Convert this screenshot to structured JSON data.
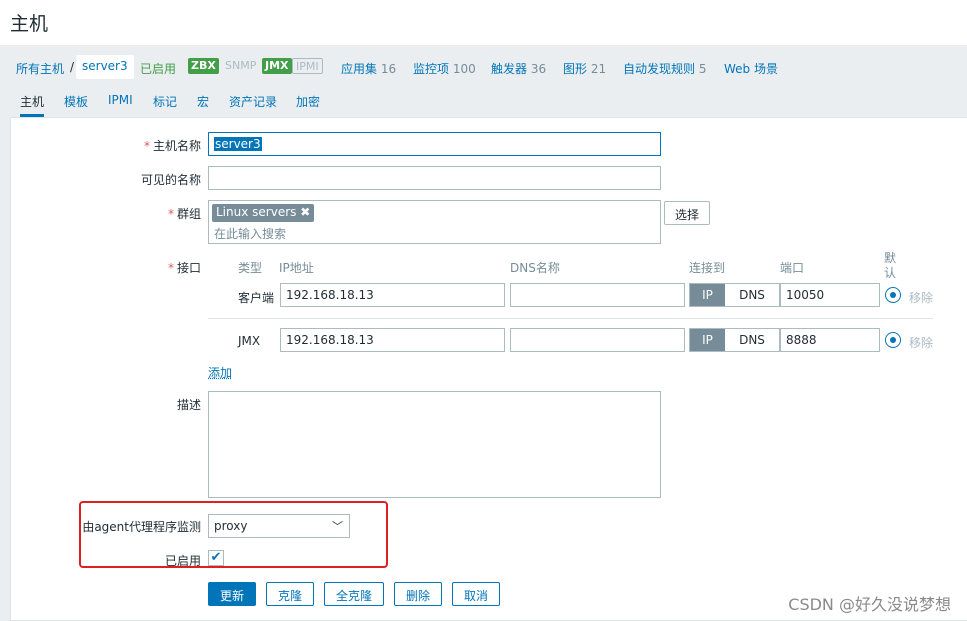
{
  "header": {
    "title": "主机"
  },
  "breadcrumb": {
    "all_hosts": "所有主机",
    "sep": "/",
    "current_host": "server3",
    "status": "已启用",
    "availability": [
      "ZBX",
      "SNMP",
      "JMX",
      "IPMI"
    ],
    "links": [
      {
        "label": "应用集",
        "count": "16"
      },
      {
        "label": "监控项",
        "count": "100"
      },
      {
        "label": "触发器",
        "count": "36"
      },
      {
        "label": "图形",
        "count": "21"
      },
      {
        "label": "自动发现规则",
        "count": "5"
      },
      {
        "label": "Web 场景",
        "count": ""
      }
    ]
  },
  "tabs": [
    "主机",
    "模板",
    "IPMI",
    "标记",
    "宏",
    "资产记录",
    "加密"
  ],
  "form": {
    "required_mark": "*",
    "host_name_label": "主机名称",
    "host_name_value": "server3",
    "visible_name_label": "可见的名称",
    "visible_name_value": "",
    "groups_label": "群组",
    "group_chip": "Linux servers",
    "group_chip_remove": "✖",
    "groups_placeholder": "在此输入搜索",
    "select_button": "选择",
    "interfaces_label": "接口",
    "iface_headers": {
      "type": "类型",
      "ip": "IP地址",
      "dns": "DNS名称",
      "connect": "连接到",
      "port": "端口",
      "default": "默认"
    },
    "interfaces": [
      {
        "type": "客户端",
        "ip": "192.168.18.13",
        "dns": "",
        "ip_btn": "IP",
        "dns_btn": "DNS",
        "port": "10050",
        "remove": "移除"
      },
      {
        "type": "JMX",
        "ip": "192.168.18.13",
        "dns": "",
        "ip_btn": "IP",
        "dns_btn": "DNS",
        "port": "8888",
        "remove": "移除"
      }
    ],
    "add_link": "添加",
    "description_label": "描述",
    "proxy_label": "由agent代理程序监测",
    "proxy_value": "proxy",
    "enabled_label": "已启用",
    "enabled_check": "✔"
  },
  "buttons": {
    "update": "更新",
    "clone": "克隆",
    "full_clone": "全克隆",
    "delete": "删除",
    "cancel": "取消"
  },
  "watermark": "CSDN @好久没说梦想",
  "colors": {
    "accent": "#0275b8",
    "green": "#429e47",
    "required": "#e45959",
    "highlight_box": "#e02020"
  }
}
